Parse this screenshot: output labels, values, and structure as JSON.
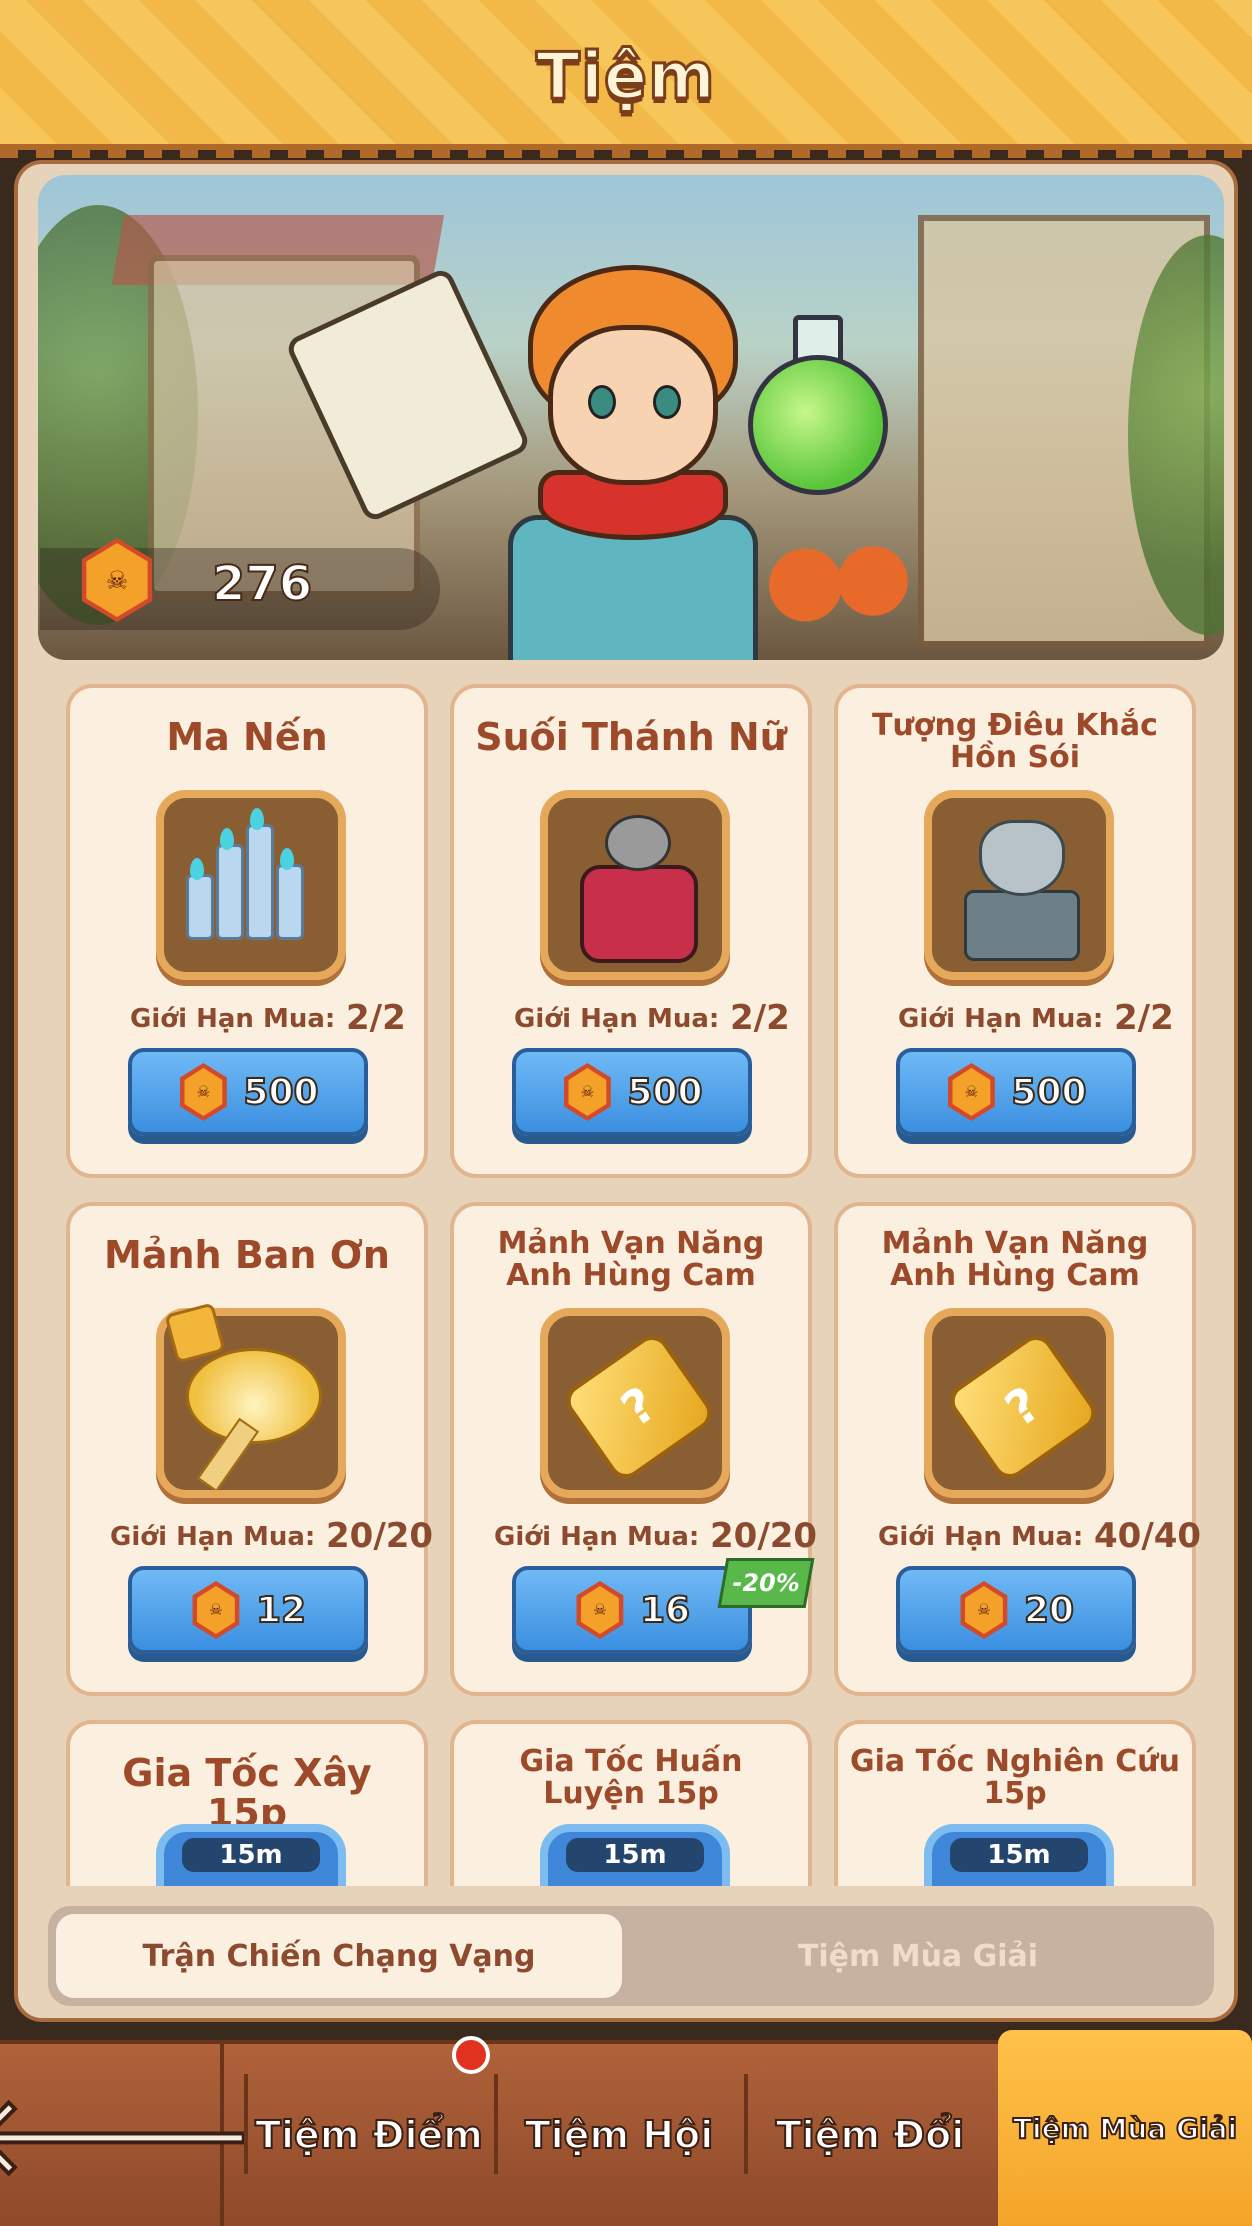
{
  "header": {
    "title": "Tiệm"
  },
  "banner": {
    "currency_icon": "skull-token-icon",
    "currency_amount": "276"
  },
  "items": [
    {
      "title": "Ma Nến",
      "icon": "candles-icon",
      "limit_label": "Giới Hạn Mua:",
      "limit": "2/2",
      "price": "500"
    },
    {
      "title": "Suối Thánh Nữ",
      "icon": "holy-well-icon",
      "limit_label": "Giới Hạn Mua:",
      "limit": "2/2",
      "price": "500"
    },
    {
      "title": "Tượng Điêu Khắc Hồn Sói",
      "icon": "wolf-statue-icon",
      "limit_label": "Giới Hạn Mua:",
      "limit": "2/2",
      "price": "500"
    },
    {
      "title": "Mảnh Ban Ơn",
      "icon": "blessing-shard-icon",
      "limit_label": "Giới Hạn Mua:",
      "limit": "20/20",
      "price": "12"
    },
    {
      "title": "Mảnh Vạn Năng Anh Hùng Cam",
      "icon": "universal-shard-icon",
      "limit_label": "Giới Hạn Mua:",
      "limit": "20/20",
      "price": "16",
      "discount": "-20%"
    },
    {
      "title": "Mảnh Vạn Năng Anh Hùng Cam",
      "icon": "universal-shard-icon",
      "limit_label": "Giới Hạn Mua:",
      "limit": "40/40",
      "price": "20"
    },
    {
      "title": "Gia Tốc Xây 15p",
      "icon": "speedup-icon",
      "badge": "15m"
    },
    {
      "title": "Gia Tốc Huấn Luyện 15p",
      "icon": "speedup-icon",
      "badge": "15m"
    },
    {
      "title": "Gia Tốc Nghiên Cứu 15p",
      "icon": "speedup-icon",
      "badge": "15m"
    }
  ],
  "subtabs": {
    "active": "Trận Chiến Chạng Vạng",
    "inactive": "Tiệm Mùa Giải"
  },
  "bottom_nav": {
    "back_icon": "back-arrow-icon",
    "tabs": [
      "Tiệm Điểm",
      "Tiệm Hội",
      "Tiệm Đổi",
      "Tiệm Mùa Giải"
    ],
    "active_index": 3
  },
  "colors": {
    "accent": "#f4a429",
    "button_blue": "#3c8fe0",
    "title_brown": "#9c4a2a",
    "discount_green": "#58b84a"
  }
}
